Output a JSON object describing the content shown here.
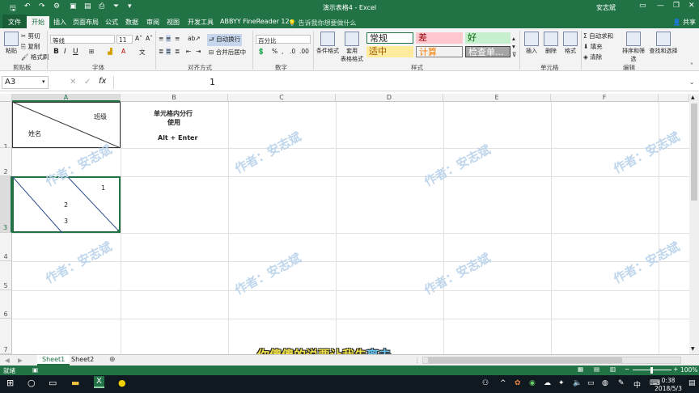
{
  "window": {
    "title": "演示表格4 - Excel",
    "user": "安志斌",
    "share": "共享"
  },
  "tabs": [
    "文件",
    "开始",
    "插入",
    "页面布局",
    "公式",
    "数据",
    "审阅",
    "视图",
    "开发工具",
    "ABBYY FineReader 12"
  ],
  "tellme": "告诉我你想要做什么",
  "ribbon": {
    "clipboard": {
      "paste": "粘贴",
      "cut": "剪切",
      "copy": "复制",
      "painter": "格式刷",
      "label": "剪贴板"
    },
    "font": {
      "name": "等线",
      "size": "11",
      "bold": "B",
      "italic": "I",
      "underline": "U",
      "label": "字体"
    },
    "align": {
      "wrap": "自动换行",
      "merge": "合并后居中",
      "label": "对齐方式"
    },
    "number": {
      "format": "百分比",
      "label": "数字"
    },
    "styles": {
      "cond": "条件格式",
      "table": "套用\n表格格式",
      "normal": "常规",
      "bad": "差",
      "good": "好",
      "neutral": "适中",
      "calc": "计算",
      "check": "检查单...",
      "label": "样式"
    },
    "cells": {
      "insert": "插入",
      "delete": "删除",
      "format": "格式",
      "label": "单元格"
    },
    "editing": {
      "autosum": "自动求和",
      "fill": "填充",
      "clear": "清除",
      "sort": "排序和筛选",
      "find": "查找和选择",
      "label": "编辑"
    }
  },
  "formula": {
    "namebox": "A3",
    "value": "1"
  },
  "columns": [
    "A",
    "B",
    "C",
    "D",
    "E",
    "F"
  ],
  "rows": [
    "1",
    "2",
    "3",
    "4",
    "5",
    "6",
    "7"
  ],
  "cells": {
    "a1_top": "班级",
    "a1_bottom": "姓名",
    "b1_line1": "单元格内分行",
    "b1_line2": "使用",
    "b1_line3": "Alt + Enter",
    "a3_1": "1",
    "a3_2": "2",
    "a3_3": "3"
  },
  "watermark": "作者：安志斌",
  "sheets": [
    "Sheet1",
    "Sheet2"
  ],
  "status": {
    "ready": "就绪",
    "zoom": "100%"
  },
  "subtitle": {
    "before": "你傻傻的说要让我先",
    "highlight": "离去"
  },
  "taskbar": {
    "time": "0:38",
    "date": "2018/5/3",
    "ime": "中"
  }
}
